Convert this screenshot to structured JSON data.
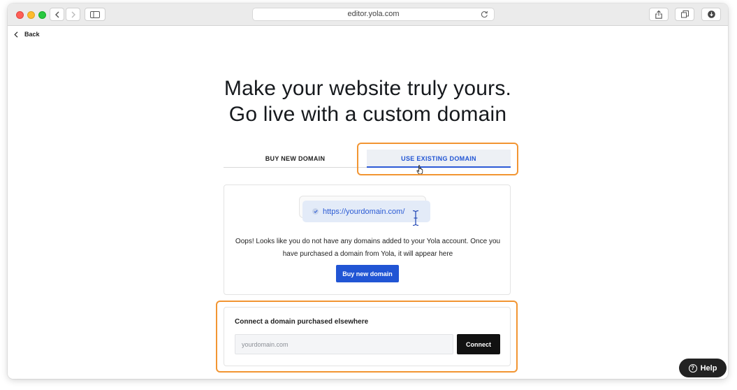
{
  "browser": {
    "url": "editor.yola.com"
  },
  "nav": {
    "back_label": "Back"
  },
  "hero": {
    "line1": "Make your website truly yours.",
    "line2": "Go live with a custom domain"
  },
  "tabs": [
    {
      "label": "BUY NEW DOMAIN",
      "active": false
    },
    {
      "label": "USE EXISTING DOMAIN",
      "active": true
    }
  ],
  "existing": {
    "url_example": "https://yourdomain.com/",
    "message": "Oops! Looks like you do not have any domains added to your Yola account. Once you have purchased a domain from Yola, it will appear here",
    "buy_button": "Buy new domain"
  },
  "connect": {
    "title": "Connect a domain purchased elsewhere",
    "input_placeholder": "yourdomain.com",
    "input_value": "",
    "button": "Connect"
  },
  "help": {
    "label": "Help"
  },
  "colors": {
    "accent": "#2155d4",
    "highlight": "#f29532",
    "dark_button": "#111111"
  }
}
